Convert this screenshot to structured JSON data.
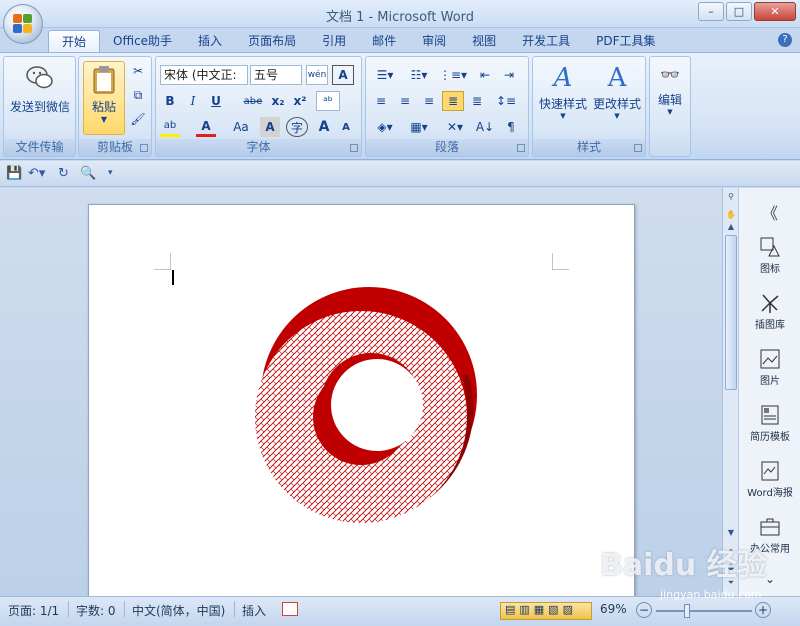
{
  "window": {
    "title": "文档 1 - Microsoft Word",
    "controls": {
      "minimize": "–",
      "maximize": "□",
      "close": "✕"
    }
  },
  "ribbon_tabs": [
    "开始",
    "Office助手",
    "插入",
    "页面布局",
    "引用",
    "邮件",
    "审阅",
    "视图",
    "开发工具",
    "PDF工具集"
  ],
  "help": "?",
  "groups": {
    "wenjian": {
      "label": "文件传输",
      "send_wechat": "发送到微信"
    },
    "clipboard": {
      "label": "剪贴板",
      "paste": "粘贴"
    },
    "font": {
      "label": "字体",
      "font_name": "宋体 (中文正:",
      "font_size": "五号",
      "bold": "B",
      "italic": "I",
      "underline": "U",
      "strike": "abe",
      "sub": "x₂",
      "sup": "x²",
      "change_case": "Aa",
      "grow": "A",
      "shrink": "A",
      "char_border": "A",
      "font_color": "A",
      "highlight": "ab",
      "wen": "wén"
    },
    "paragraph": {
      "label": "段落"
    },
    "styles": {
      "label": "样式",
      "quick_styles": "快速样式",
      "change_styles": "更改样式"
    },
    "editing": {
      "label": "编辑"
    }
  },
  "side_panel": {
    "items": [
      "图标",
      "插图库",
      "图片",
      "简历模板",
      "Word海报",
      "办公常用"
    ]
  },
  "status": {
    "page": "页面: 1/1",
    "words": "字数: 0",
    "lang": "中文(简体，中国)",
    "mode": "插入",
    "zoom": "69%"
  },
  "watermark": {
    "brand": "Baidu 经验",
    "url": "jingyan.baidu.com"
  },
  "colors": {
    "ring_red": "#c00000",
    "accent": "#15428b"
  }
}
